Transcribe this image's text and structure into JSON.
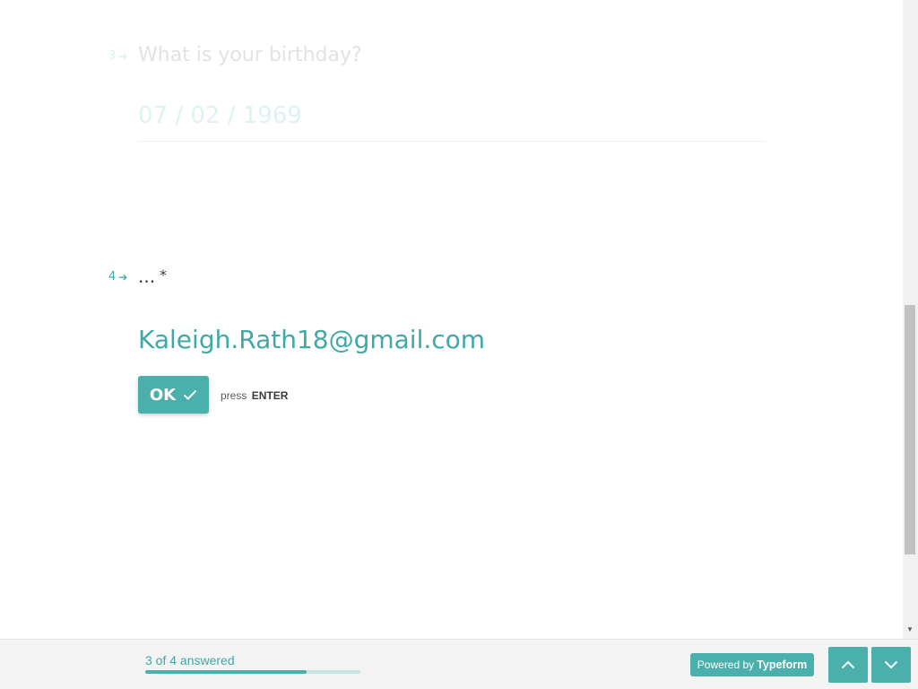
{
  "questions": {
    "previous": {
      "number": "3",
      "title": "What is your birthday?",
      "value": "07 / 02 / 1969"
    },
    "current": {
      "number": "4",
      "title": "...",
      "required_marker": "*",
      "value": "Kaleigh.Rath18@gmail.com"
    }
  },
  "actions": {
    "ok_label": "OK",
    "hint_prefix": "press",
    "hint_key": "ENTER"
  },
  "footer": {
    "progress_text": "3 of 4 answered",
    "progress_fraction": 0.75,
    "powered_prefix": "Powered by",
    "powered_brand": "Typeform"
  },
  "icons": {
    "question_arrow": "arrow-right-icon",
    "ok_check": "check-icon",
    "nav_up": "chevron-up-icon",
    "nav_down": "chevron-down-icon"
  },
  "colors": {
    "accent": "#4bb0ac",
    "accent_text": "#3fa9a6",
    "footer_bg": "#f3f3f3"
  }
}
